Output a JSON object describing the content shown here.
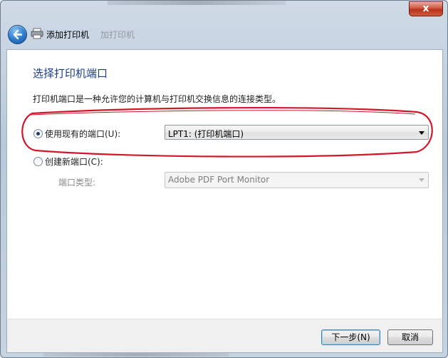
{
  "window": {
    "close_label": "x",
    "title": "添加打印机",
    "ghost_text": "加打印机"
  },
  "page": {
    "heading": "选择打印机端口",
    "description": "打印机端口是一种允许您的计算机与打印机交换信息的连接类型。"
  },
  "use_existing": {
    "label": "使用现有的端口(U):",
    "selected": true,
    "value": "LPT1: (打印机端口)"
  },
  "create_new": {
    "label": "创建新端口(C):",
    "selected": false,
    "port_type_label": "端口类型:",
    "port_type_value": "Adobe PDF Port Monitor"
  },
  "buttons": {
    "next": "下一步(N)",
    "cancel": "取消"
  },
  "colors": {
    "annotation": "#d0182a",
    "heading": "#1d3d8a"
  }
}
